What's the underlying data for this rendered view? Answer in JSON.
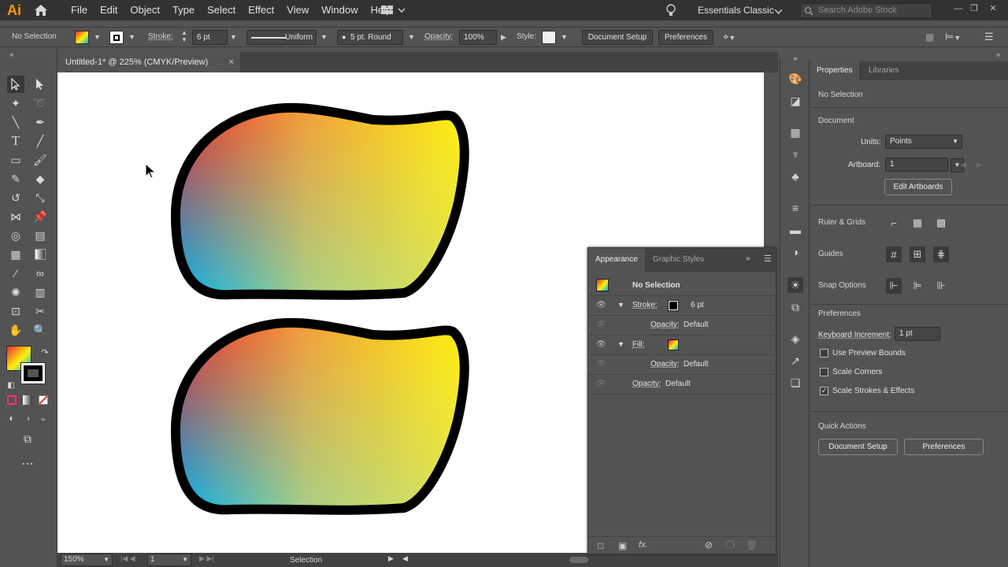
{
  "app": {
    "logo": "Ai"
  },
  "menu": [
    "File",
    "Edit",
    "Object",
    "Type",
    "Select",
    "Effect",
    "View",
    "Window",
    "Help"
  ],
  "workspace": "Essentials Classic",
  "search": {
    "placeholder": "Search Adobe Stock"
  },
  "control_bar": {
    "selection": "No Selection",
    "stroke_label": "Stroke:",
    "stroke_weight": "6 pt",
    "profile": "Uniform",
    "brush": "5 pt. Round",
    "opacity_label": "Opacity:",
    "opacity": "100%",
    "style_label": "Style:",
    "document_setup": "Document Setup",
    "preferences": "Preferences"
  },
  "document_tab": {
    "title": "Untitled-1* @ 225% (CMYK/Preview)",
    "close": "×"
  },
  "status": {
    "zoom": "150%",
    "artboard": "1",
    "tool": "Selection"
  },
  "properties": {
    "tabs": [
      "Properties",
      "Libraries"
    ],
    "selection": "No Selection",
    "document_title": "Document",
    "units_label": "Units:",
    "units_value": "Points",
    "artboard_label": "Artboard:",
    "artboard_value": "1",
    "edit_artboards": "Edit Artboards",
    "ruler_grids": "Ruler & Grids",
    "guides": "Guides",
    "snap_options": "Snap Options",
    "preferences_title": "Preferences",
    "keyboard_increment_label": "Keyboard Increment:",
    "keyboard_increment_value": "1 pt",
    "use_preview_bounds": "Use Preview Bounds",
    "scale_corners": "Scale Corners",
    "scale_strokes": "Scale Strokes & Effects",
    "scale_strokes_checked": true,
    "quick_actions": "Quick Actions",
    "document_setup": "Document Setup",
    "preferences_btn": "Preferences"
  },
  "appearance": {
    "tabs": [
      "Appearance",
      "Graphic Styles"
    ],
    "header": "No Selection",
    "stroke_label": "Stroke:",
    "stroke_value": "6 pt",
    "opacity_label": "Opacity:",
    "opacity_value": "Default",
    "fill_label": "Fill:",
    "fx": "fx."
  },
  "colors": {
    "gradient_top_left": "#ef2a2a",
    "gradient_top_right": "#fff10c",
    "gradient_bottom_left": "#00b0f0",
    "stroke": "#000000",
    "ui_dark": "#535353"
  }
}
